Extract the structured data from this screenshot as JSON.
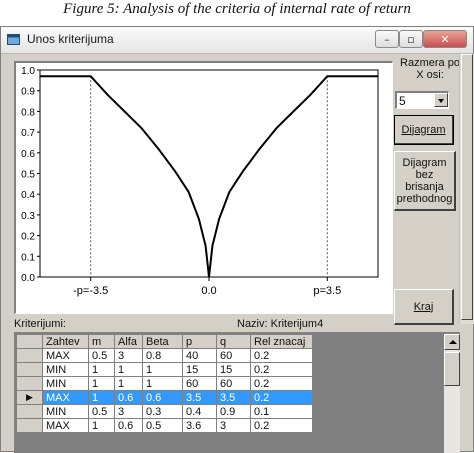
{
  "caption": "Figure 5: Analysis of the criteria of internal rate of return",
  "window": {
    "title": "Unos kriterijuma",
    "min_label": "–",
    "max_label": "▫",
    "close_label": "✕"
  },
  "chart_data": {
    "type": "line",
    "x": [
      -5,
      -3.5,
      -3,
      -2.5,
      -2,
      -1.5,
      -1,
      -0.6,
      -0.3,
      -0.1,
      0,
      0.1,
      0.3,
      0.6,
      1,
      1.5,
      2,
      2.5,
      3,
      3.5,
      5
    ],
    "y": [
      0.97,
      0.97,
      0.88,
      0.8,
      0.72,
      0.62,
      0.51,
      0.41,
      0.28,
      0.15,
      0.0,
      0.15,
      0.28,
      0.41,
      0.51,
      0.62,
      0.72,
      0.8,
      0.88,
      0.97,
      0.97
    ],
    "ylim": [
      0,
      1
    ],
    "xlim": [
      -5,
      5
    ],
    "yticks": [
      "1.0",
      "0.9",
      "0.8",
      "0.7",
      "0.6",
      "0.5",
      "0.4",
      "0.3",
      "0.2",
      "0.1",
      "0.0"
    ],
    "xticks": [
      {
        "value": -3.5,
        "label": "-p=-3.5"
      },
      {
        "value": 0,
        "label": "0.0"
      },
      {
        "value": 3.5,
        "label": "p=3.5"
      }
    ],
    "reference_lines_x": [
      -3.5,
      3.5
    ],
    "grid": false,
    "line_color": "#000000"
  },
  "controls": {
    "scale_label": "Razmera po\nX osi:",
    "scale_value": "5",
    "diagram_button": "Dijagram",
    "diagram_nodelete_button": "Dijagram\nbez brisanja\nprethodnog",
    "exit_button": "Kraj"
  },
  "criteria": {
    "label": "Kriterijumi:",
    "name_label": "Naziv: Kriterijum4",
    "columns": [
      "Zahtev",
      "m",
      "Alfa",
      "Beta",
      "p",
      "q",
      "Rel znacaj"
    ],
    "rows": [
      [
        "MAX",
        "0.5",
        "3",
        "0.8",
        "40",
        "60",
        "0.2"
      ],
      [
        "MIN",
        "1",
        "1",
        "1",
        "15",
        "15",
        "0.2"
      ],
      [
        "MIN",
        "1",
        "1",
        "1",
        "60",
        "60",
        "0.2"
      ],
      [
        "MAX",
        "1",
        "0.6",
        "0.6",
        "3.5",
        "3.5",
        "0.2"
      ],
      [
        "MIN",
        "0.5",
        "3",
        "0.3",
        "0.4",
        "0.9",
        "0.1"
      ],
      [
        "MAX",
        "1",
        "0.6",
        "0.5",
        "3.6",
        "3",
        "0.2"
      ]
    ],
    "selected_row": 3,
    "row_marker": "▶"
  }
}
